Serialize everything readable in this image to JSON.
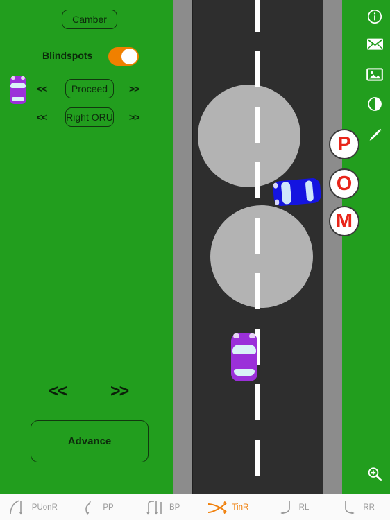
{
  "app": {
    "theme": {
      "grass_green": "#229E1E",
      "road_dark": "#2E2E2E",
      "pavement_gray": "#8C8C8C",
      "obstacle_gray": "#B3B3B3",
      "toggle_on_orange": "#F08000",
      "active_tab_orange": "#F0800C",
      "marker_red": "#E8251A",
      "ego_car_purple": "#9B30D9",
      "other_car_blue": "#1414E0",
      "lane_line_white": "#FFFFFF"
    }
  },
  "controls": {
    "camber_label": "Camber",
    "blindspots_label": "Blindspots",
    "blindspots_state": "on",
    "manoeuvre_stage_label": "Proceed",
    "manoeuvre_stage_prev": "<<",
    "manoeuvre_stage_next": ">>",
    "observation_label": "Right ORU",
    "observation_prev": "<<",
    "observation_next": ">>",
    "step_prev": "<<",
    "step_next": ">>",
    "advance_label": "Advance",
    "ego_car_icon": "car-top-view-purple-icon"
  },
  "scene": {
    "pom_markers": [
      {
        "letter": "P",
        "name": "prepare-marker"
      },
      {
        "letter": "O",
        "name": "observe-marker"
      },
      {
        "letter": "M",
        "name": "manoeuvre-marker"
      }
    ],
    "vehicles": [
      {
        "name": "ego-vehicle",
        "color": "#9B30D9",
        "heading": "up"
      },
      {
        "name": "oncoming-vehicle",
        "color": "#1414E0",
        "heading": "left"
      }
    ],
    "obstacles": [
      {
        "name": "roundabout-obstacle-1",
        "shape": "circle"
      },
      {
        "name": "roundabout-obstacle-2",
        "shape": "circle"
      }
    ]
  },
  "rail": {
    "items": [
      {
        "name": "info-icon",
        "label": "Info"
      },
      {
        "name": "mail-icon",
        "label": "Mail"
      },
      {
        "name": "image-icon",
        "label": "Image"
      },
      {
        "name": "contrast-icon",
        "label": "Contrast"
      },
      {
        "name": "pencil-icon",
        "label": "Draw"
      },
      {
        "name": "zoom-in-icon",
        "label": "Zoom"
      }
    ]
  },
  "tabs": [
    {
      "label": "PUonR",
      "icon": "pull-up-on-right-icon",
      "active": false
    },
    {
      "label": "PP",
      "icon": "parallel-park-icon",
      "active": false
    },
    {
      "label": "BP",
      "icon": "bay-park-icon",
      "active": false
    },
    {
      "label": "TinR",
      "icon": "turn-in-road-icon",
      "active": true
    },
    {
      "label": "RL",
      "icon": "reverse-left-icon",
      "active": false
    },
    {
      "label": "RR",
      "icon": "reverse-right-icon",
      "active": false
    }
  ]
}
